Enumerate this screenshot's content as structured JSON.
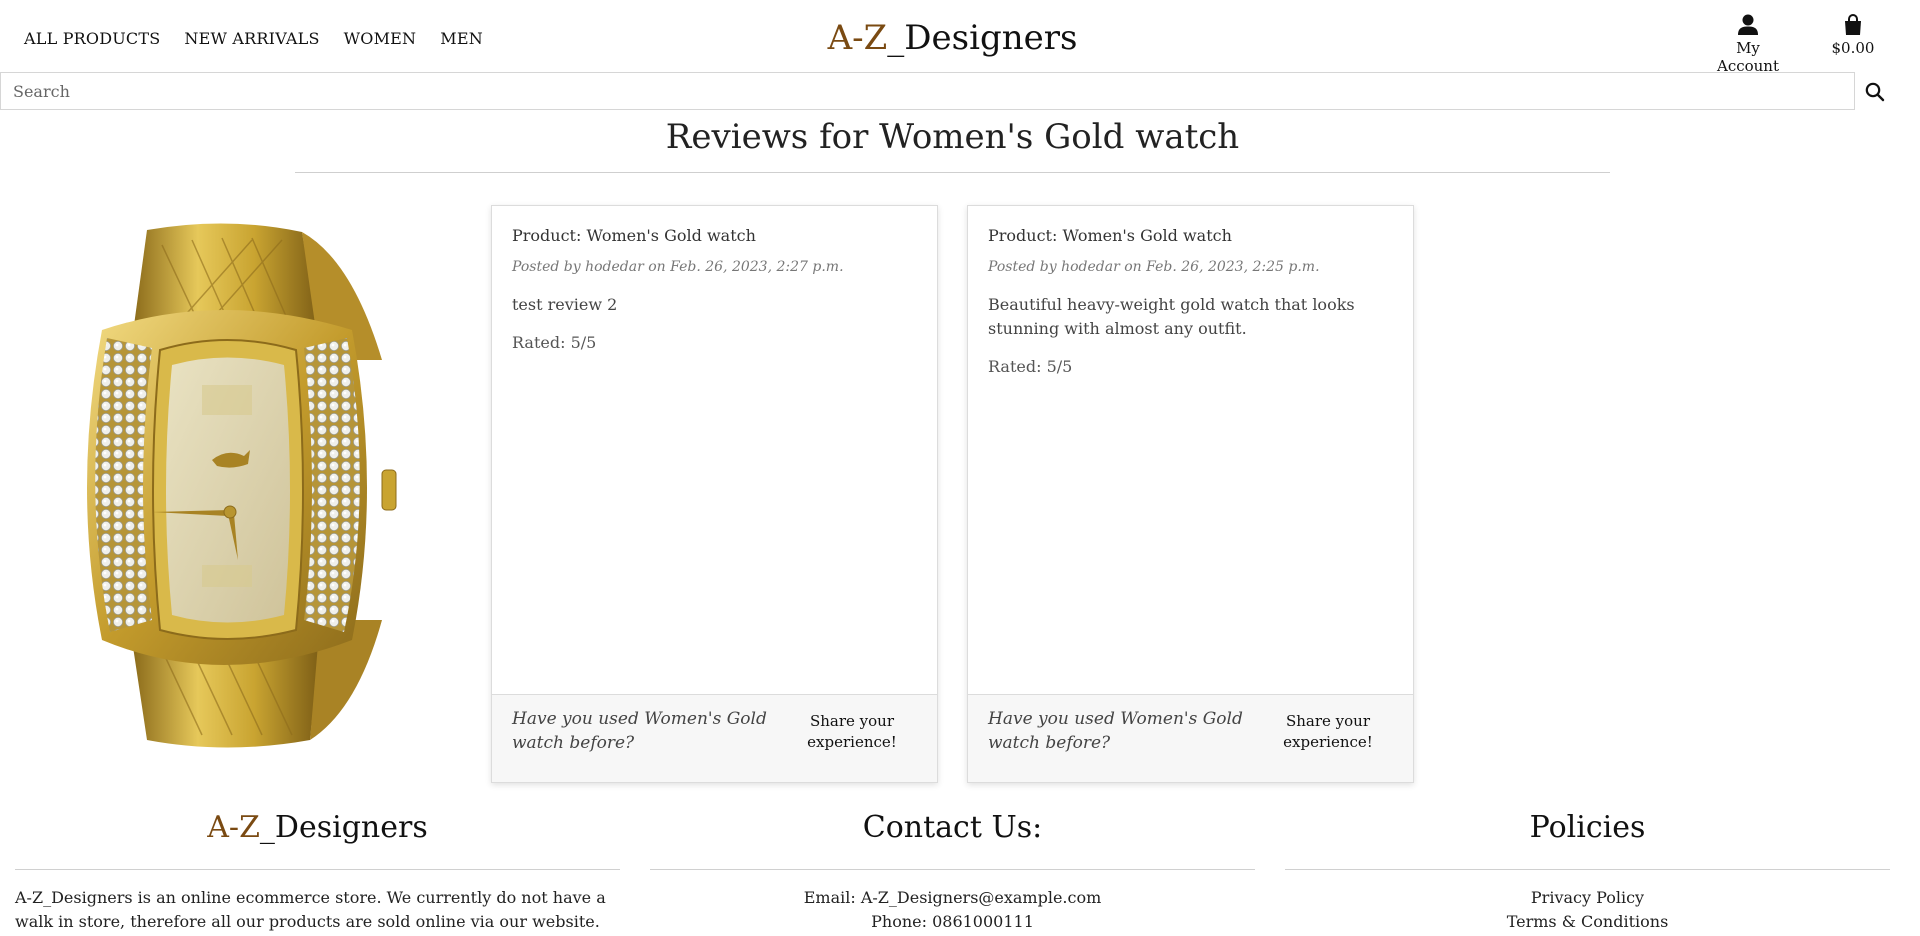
{
  "nav": {
    "items": [
      "ALL PRODUCTS",
      "NEW ARRIVALS",
      "WOMEN",
      "MEN"
    ]
  },
  "logo": {
    "part1": "A-Z",
    "part2": "_Designers"
  },
  "account": {
    "label": "My Account",
    "icon": "user-icon"
  },
  "bag": {
    "total": "$0.00",
    "icon": "shopping-bag-icon"
  },
  "search": {
    "placeholder": "Search",
    "icon": "search-icon"
  },
  "page": {
    "title": "Reviews for Women's Gold watch"
  },
  "reviews": [
    {
      "product": "Product: Women's Gold watch",
      "posted": "Posted by hodedar on Feb. 26, 2023, 2:27 p.m.",
      "text": "test review 2",
      "rating": "Rated: 5/5",
      "question": "Have you used Women's Gold watch before?",
      "share": "Share your experience!"
    },
    {
      "product": "Product: Women's Gold watch",
      "posted": "Posted by hodedar on Feb. 26, 2023, 2:25 p.m.",
      "text": "Beautiful heavy-weight gold watch that looks stunning with almost any outfit.",
      "rating": "Rated: 5/5",
      "question": "Have you used Women's Gold watch before?",
      "share": "Share your experience!"
    }
  ],
  "footer": {
    "brand": {
      "part1": "A-Z",
      "part2": "_Designers"
    },
    "about": "A-Z_Designers is an online ecommerce store. We currently do not have a walk in store, therefore all our products are sold online via our website. A-Z_Designers",
    "contact_title": "Contact Us:",
    "email": "Email: A-Z_Designers@example.com",
    "phone": "Phone: 0861000111",
    "policies_title": "Policies",
    "policy_links": [
      "Privacy Policy",
      "Terms & Conditions"
    ]
  },
  "colors": {
    "brand_gold": "#7a4a12",
    "text": "#222222",
    "watch_gold": "#c9a431"
  }
}
